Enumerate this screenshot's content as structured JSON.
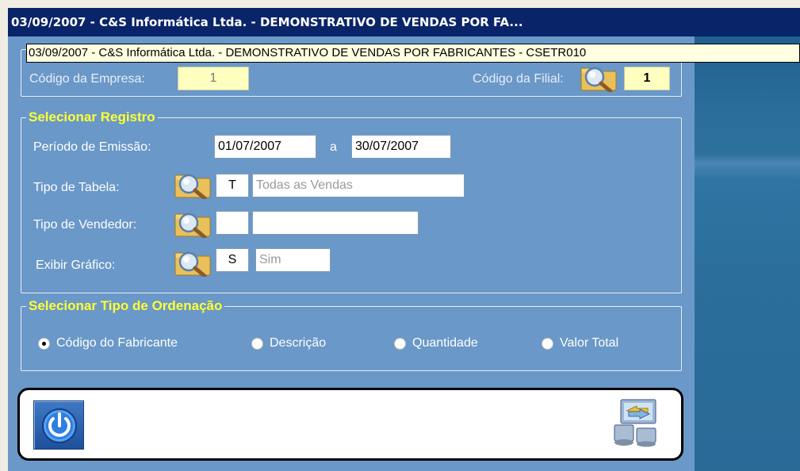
{
  "window": {
    "title": "03/09/2007  -  C&S Informática Ltda.  -  DEMONSTRATIVO DE VENDAS POR FA..."
  },
  "tooltip": {
    "text": "03/09/2007  -  C&S Informática Ltda.  -  DEMONSTRATIVO DE VENDAS POR FABRICANTES  -  CSETR010"
  },
  "company": {
    "empresa_label": "Código da Empresa:",
    "empresa_value": "1",
    "filial_label": "Código da Filial:",
    "filial_value": "1"
  },
  "registro": {
    "legend": "Selecionar Registro",
    "periodo_label": "Período de Emissão:",
    "data_inicio": "01/07/2007",
    "separator": "a",
    "data_fim": "30/07/2007",
    "tipo_tabela_label": "Tipo de Tabela:",
    "tipo_tabela_code": "T",
    "tipo_tabela_desc": "Todas as Vendas",
    "tipo_vendedor_label": "Tipo de Vendedor:",
    "tipo_vendedor_code": "",
    "tipo_vendedor_desc": "",
    "exibir_grafico_label": "Exibir Gráfico:",
    "exibir_grafico_code": "S",
    "exibir_grafico_desc": "Sim"
  },
  "ordenacao": {
    "legend": "Selecionar Tipo de Ordenação",
    "options": [
      {
        "label": "Código do Fabricante",
        "selected": true
      },
      {
        "label": "Descrição",
        "selected": false
      },
      {
        "label": "Quantidade",
        "selected": false
      },
      {
        "label": "Valor Total",
        "selected": false
      }
    ]
  },
  "icons": {
    "lookup": "folder-magnifier-icon",
    "exit": "power-icon",
    "export": "monitor-transfer-icon"
  },
  "colors": {
    "title_bar": "#0a246a",
    "window_bg": "#6a98c8",
    "legend_text": "#ffff33",
    "tooltip_bg": "#ffffe1"
  }
}
